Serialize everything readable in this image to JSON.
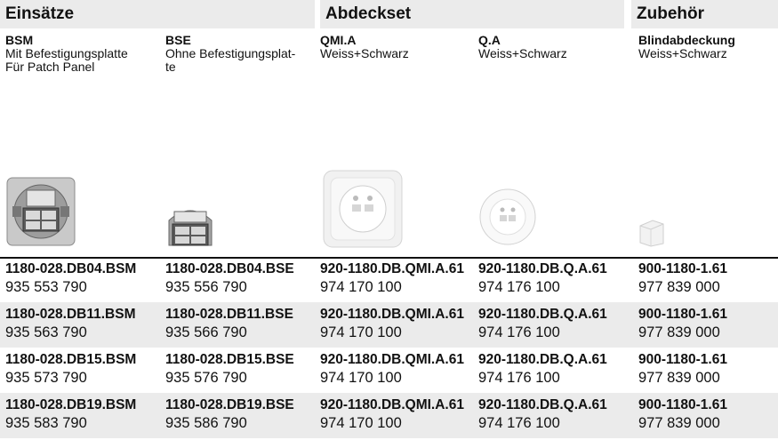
{
  "groups": {
    "einsaetze": "Einsätze",
    "abdeckset": "Abdeckset",
    "zubehoer": "Zubehör"
  },
  "columns": [
    {
      "title": "BSM",
      "desc1": "Mit Befestigungsplatte",
      "desc2": "Für Patch Panel"
    },
    {
      "title": "BSE",
      "desc1": "Ohne Befestigungsplat-",
      "desc2": "te"
    },
    {
      "title": "QMI.A",
      "desc1": "Weiss+Schwarz",
      "desc2": ""
    },
    {
      "title": "Q.A",
      "desc1": "Weiss+Schwarz",
      "desc2": ""
    },
    {
      "title": "Blindabdeckung",
      "desc1": "Weiss+Schwarz",
      "desc2": ""
    }
  ],
  "rows": [
    {
      "cells": [
        {
          "code": "1180-028.DB04.BSM",
          "num": "935 553 790"
        },
        {
          "code": "1180-028.DB04.BSE",
          "num": "935 556 790"
        },
        {
          "code": "920-1180.DB.QMI.A.61",
          "num": "974 170 100"
        },
        {
          "code": "920-1180.DB.Q.A.61",
          "num": "974 176 100"
        },
        {
          "code": "900-1180-1.61",
          "num": "977 839 000"
        }
      ]
    },
    {
      "cells": [
        {
          "code": "1180-028.DB11.BSM",
          "num": "935 563 790"
        },
        {
          "code": "1180-028.DB11.BSE",
          "num": "935 566 790"
        },
        {
          "code": "920-1180.DB.QMI.A.61",
          "num": "974 170 100"
        },
        {
          "code": "920-1180.DB.Q.A.61",
          "num": "974 176 100"
        },
        {
          "code": "900-1180-1.61",
          "num": "977 839 000"
        }
      ]
    },
    {
      "cells": [
        {
          "code": "1180-028.DB15.BSM",
          "num": "935 573 790"
        },
        {
          "code": "1180-028.DB15.BSE",
          "num": "935 576 790"
        },
        {
          "code": "920-1180.DB.QMI.A.61",
          "num": "974 170 100"
        },
        {
          "code": "920-1180.DB.Q.A.61",
          "num": "974 176 100"
        },
        {
          "code": "900-1180-1.61",
          "num": "977 839 000"
        }
      ]
    },
    {
      "cells": [
        {
          "code": "1180-028.DB19.BSM",
          "num": "935 583 790"
        },
        {
          "code": "1180-028.DB19.BSE",
          "num": "935 586 790"
        },
        {
          "code": "920-1180.DB.QMI.A.61",
          "num": "974 170 100"
        },
        {
          "code": "920-1180.DB.Q.A.61",
          "num": "974 176 100"
        },
        {
          "code": "900-1180-1.61",
          "num": "977 839 000"
        }
      ]
    }
  ]
}
